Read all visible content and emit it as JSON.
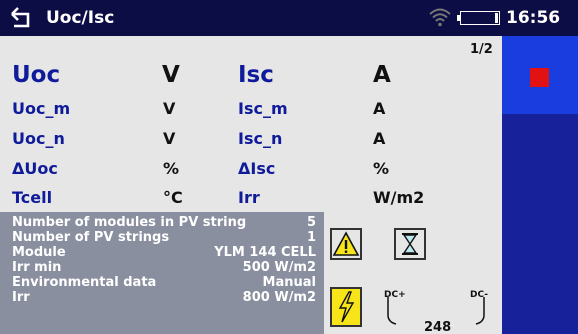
{
  "header": {
    "title": "Uoc/Isc",
    "time": "16:56",
    "icons": {
      "back": "back-arrow-icon",
      "wifi": "wifi-icon",
      "battery": "battery-icon"
    }
  },
  "page_indicator": "1/2",
  "results": {
    "rows": [
      {
        "name1": "Uoc",
        "unit1": "V",
        "name2": "Isc",
        "unit2": "A"
      },
      {
        "name1": "Uoc_m",
        "unit1": "V",
        "name2": "Isc_m",
        "unit2": "A"
      },
      {
        "name1": "Uoc_n",
        "unit1": "V",
        "name2": "Isc_n",
        "unit2": "A"
      },
      {
        "name1": "ΔUoc",
        "unit1": "%",
        "name2": "ΔIsc",
        "unit2": "%"
      },
      {
        "name1": "Tcell",
        "unit1": "°C",
        "name2": "Irr",
        "unit2": "W/m2"
      }
    ]
  },
  "parameters": [
    {
      "label": "Number of modules in PV string",
      "value": "5"
    },
    {
      "label": "Number of PV strings",
      "value": "1"
    },
    {
      "label": "Module",
      "value": "YLM 144 CELL"
    },
    {
      "label": "Irr min",
      "value": "500 W/m2"
    },
    {
      "label": "Environmental data",
      "value": "Manual"
    },
    {
      "label": "Irr",
      "value": "800 W/m2"
    }
  ],
  "indicators": {
    "warning": "warning-icon",
    "hourglass": "hourglass-icon",
    "high_voltage": "high-voltage-icon"
  },
  "terminals": {
    "plus": "DC+",
    "minus": "DC-",
    "voltage": "248"
  },
  "side_panel": {
    "stop_icon": "stop-icon"
  },
  "colors": {
    "header_bg": "#0d0d45",
    "label_blue": "#0f1b9a",
    "panel_bg": "#e6e6e6",
    "params_bg": "#8a8fa0",
    "side_bg": "#16219a",
    "side_active": "#1a3de0",
    "stop_red": "#e21212",
    "warning_yellow": "#f7e51a"
  }
}
